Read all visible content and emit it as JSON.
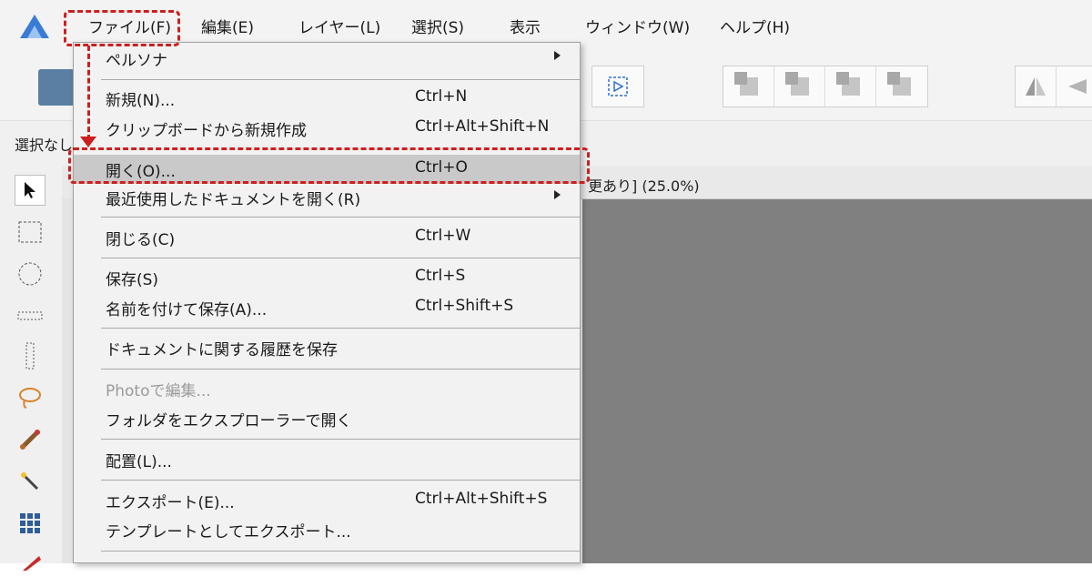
{
  "menubar": {
    "items": [
      "ファイル(F)",
      "編集(E)",
      "レイヤー(L)",
      "選択(S)",
      "表示",
      "ウィンドウ(W)",
      "ヘルプ(H)"
    ]
  },
  "context_bar": {
    "label": "選択なし"
  },
  "document": {
    "tab_text": "更あり] (25.0%)"
  },
  "file_menu": {
    "items": [
      {
        "label": "ペルソナ",
        "shortcut": "",
        "submenu": true,
        "enabled": true
      },
      {
        "label": "新規(N)...",
        "shortcut": "Ctrl+N",
        "submenu": false,
        "enabled": true
      },
      {
        "label": "クリップボードから新規作成",
        "shortcut": "Ctrl+Alt+Shift+N",
        "submenu": false,
        "enabled": true
      },
      {
        "label": "開く(O)...",
        "shortcut": "Ctrl+O",
        "submenu": false,
        "enabled": true,
        "highlighted": true
      },
      {
        "label": "最近使用したドキュメントを開く(R)",
        "shortcut": "",
        "submenu": true,
        "enabled": true
      },
      {
        "label": "閉じる(C)",
        "shortcut": "Ctrl+W",
        "submenu": false,
        "enabled": true
      },
      {
        "label": "保存(S)",
        "shortcut": "Ctrl+S",
        "submenu": false,
        "enabled": true
      },
      {
        "label": "名前を付けて保存(A)...",
        "shortcut": "Ctrl+Shift+S",
        "submenu": false,
        "enabled": true
      },
      {
        "label": "ドキュメントに関する履歴を保存",
        "shortcut": "",
        "submenu": false,
        "enabled": true
      },
      {
        "label": "Photoで編集...",
        "shortcut": "",
        "submenu": false,
        "enabled": false
      },
      {
        "label": "フォルダをエクスプローラーで開く",
        "shortcut": "",
        "submenu": false,
        "enabled": true
      },
      {
        "label": "配置(L)...",
        "shortcut": "",
        "submenu": false,
        "enabled": true
      },
      {
        "label": "エクスポート(E)...",
        "shortcut": "Ctrl+Alt+Shift+S",
        "submenu": false,
        "enabled": true
      },
      {
        "label": "テンプレートとしてエクスポート...",
        "shortcut": "",
        "submenu": false,
        "enabled": true
      }
    ]
  },
  "colors": {
    "annotation": "#cc1f1f",
    "canvas": "#808080",
    "menu_bg": "#f2f2f2",
    "highlight": "#c9c9c9"
  },
  "icons": [
    "affinity-designer-logo",
    "persona-logo",
    "artboard-icon",
    "arrange-icons",
    "flip-icon",
    "move-tool-icon",
    "rectangle-marquee-icon",
    "ellipse-marquee-icon",
    "row-marquee-icon",
    "column-marquee-icon",
    "lasso-icon",
    "brush-icon",
    "magic-wand-icon",
    "grid-icon",
    "pen-icon"
  ]
}
